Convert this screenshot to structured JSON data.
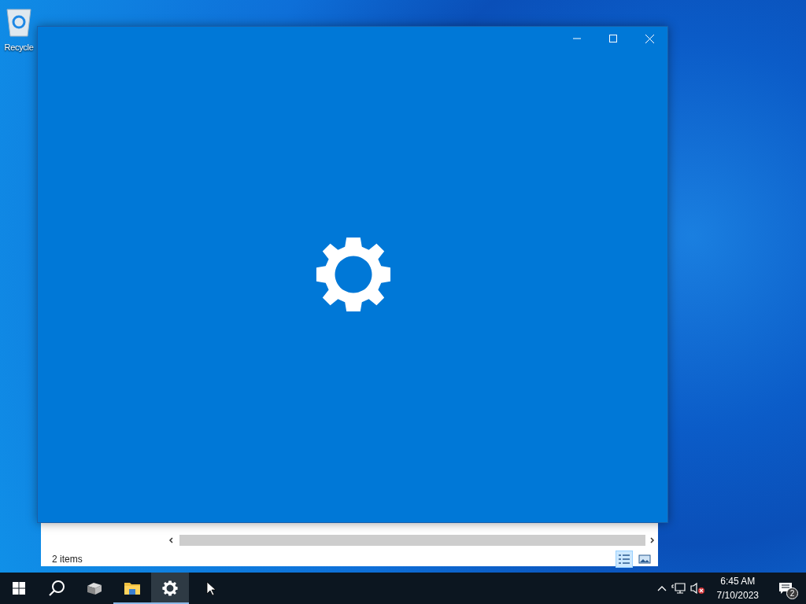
{
  "desktop_icons": [
    {
      "label": "Recycle"
    }
  ],
  "explorer_window": {
    "status": "2 items",
    "views": [
      {
        "kind": "details",
        "selected": true
      },
      {
        "kind": "preview",
        "selected": false
      }
    ]
  },
  "settings_window": {
    "controls": [
      {
        "kind": "minimize"
      },
      {
        "kind": "maximize"
      },
      {
        "kind": "close"
      }
    ]
  },
  "taskbar": {
    "apps": [
      {
        "kind": "server",
        "running": false,
        "selected": false
      },
      {
        "kind": "folder",
        "running": true,
        "selected": false
      },
      {
        "kind": "gear",
        "running": true,
        "selected": true
      }
    ],
    "time": "6:45 AM",
    "date": "7/10/2023",
    "notifications": "2"
  }
}
